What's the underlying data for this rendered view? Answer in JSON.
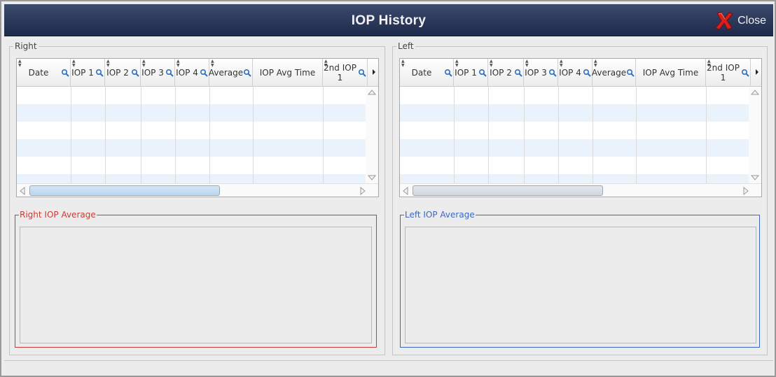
{
  "window": {
    "title": "IOP History",
    "close_label": "Close"
  },
  "columns": [
    {
      "label": "Date",
      "search": true
    },
    {
      "label": "IOP 1",
      "search": true
    },
    {
      "label": "IOP 2",
      "search": true
    },
    {
      "label": "IOP 3",
      "search": true
    },
    {
      "label": "IOP 4",
      "search": true
    },
    {
      "label": "Average",
      "search": true
    },
    {
      "label": "IOP Avg Time",
      "search": false
    },
    {
      "label": "2nd IOP 1",
      "search": true
    }
  ],
  "right": {
    "legend": "Right",
    "average_label": "Right IOP Average"
  },
  "left": {
    "legend": "Left",
    "average_label": "Left IOP Average"
  },
  "colors": {
    "right_accent": "#cc3a34",
    "left_accent": "#3a67c4",
    "titlebar": "#1e2a4a",
    "row_stripe": "#eaf3fc"
  },
  "icons": {
    "close": "close-x-icon",
    "search": "search-icon",
    "sort": "sort-icon"
  }
}
